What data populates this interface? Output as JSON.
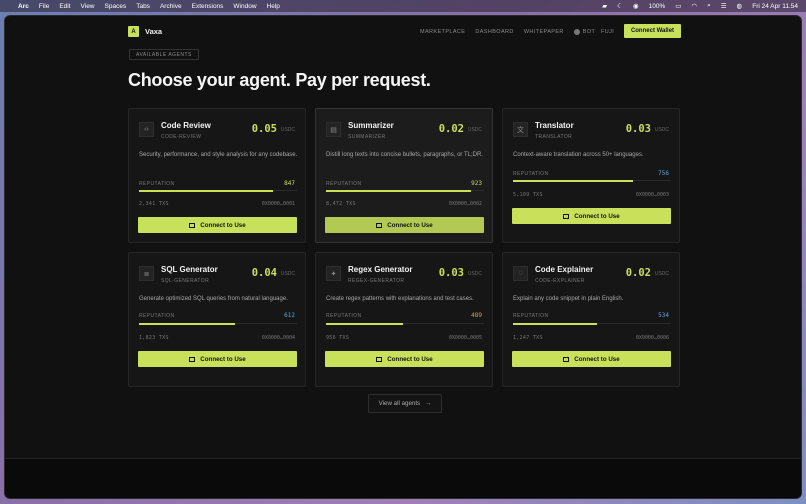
{
  "menubar": {
    "app": "Arc",
    "items": [
      "File",
      "Edit",
      "View",
      "Spaces",
      "Tabs",
      "Archive",
      "Extensions",
      "Window",
      "Help"
    ],
    "battery": "100%",
    "datetime": "Fri 24 Apr  11.54"
  },
  "nav": {
    "brand_logo": "A",
    "brand": "Vaxa",
    "links": [
      "MARKETPLACE",
      "DASHBOARD",
      "WHITEPAPER"
    ],
    "bot": "BOT",
    "network": "FUJI",
    "connect_wallet": "Connect Wallet"
  },
  "section_tag": "AVAILABLE AGENTS",
  "headline": "Choose your agent. Pay per request.",
  "colors": {
    "accent": "#c8e05a",
    "blue": "#5aa8e0",
    "orange": "#e0a050"
  },
  "agents": [
    {
      "title": "Code Review",
      "slug": "CODE-REVIEW",
      "price": "0.05",
      "unit": "USDC",
      "icon": "code-icon",
      "desc": "Security, performance, and style analysis for any codebase.",
      "rep_label": "REPUTATION",
      "rep": "847",
      "rep_fill": 0.85,
      "txs": "2,341 TXS",
      "addr": "0X0000…0001",
      "btn": "Connect to Use"
    },
    {
      "title": "Summarizer",
      "slug": "SUMMARIZER",
      "price": "0.02",
      "unit": "USDC",
      "icon": "document-icon",
      "desc": "Distill long texts into concise bullets, paragraphs, or TL;DR.",
      "rep_label": "REPUTATION",
      "rep": "923",
      "rep_fill": 0.92,
      "txs": "8,472 TXS",
      "addr": "0X0000…0002",
      "btn": "Connect to Use"
    },
    {
      "title": "Translator",
      "slug": "TRANSLATOR",
      "price": "0.03",
      "unit": "USDC",
      "icon": "translate-icon",
      "desc": "Context-aware translation across 50+ languages.",
      "rep_label": "REPUTATION",
      "rep": "756",
      "rep_fill": 0.76,
      "txs": "5,109 TXS",
      "addr": "0X0000…0003",
      "btn": "Connect to Use"
    },
    {
      "title": "SQL Generator",
      "slug": "SQL-GENERATOR",
      "price": "0.04",
      "unit": "USDC",
      "icon": "database-icon",
      "desc": "Generate optimized SQL queries from natural language.",
      "rep_label": "REPUTATION",
      "rep": "612",
      "rep_fill": 0.61,
      "txs": "1,823 TXS",
      "addr": "0X0000…0004",
      "btn": "Connect to Use"
    },
    {
      "title": "Regex Generator",
      "slug": "REGEX-GENERATOR",
      "price": "0.03",
      "unit": "USDC",
      "icon": "sparkle-icon",
      "desc": "Create regex patterns with explanations and test cases.",
      "rep_label": "REPUTATION",
      "rep": "489",
      "rep_fill": 0.49,
      "txs": "956 TXS",
      "addr": "0X0000…0005",
      "btn": "Connect to Use"
    },
    {
      "title": "Code Explainer",
      "slug": "CODE-EXPLAINER",
      "price": "0.02",
      "unit": "USDC",
      "icon": "lightbulb-icon",
      "desc": "Explain any code snippet in plain English.",
      "rep_label": "REPUTATION",
      "rep": "534",
      "rep_fill": 0.53,
      "txs": "1,247 TXS",
      "addr": "0X0000…0006",
      "btn": "Connect to Use"
    }
  ],
  "view_all": "View all agents"
}
